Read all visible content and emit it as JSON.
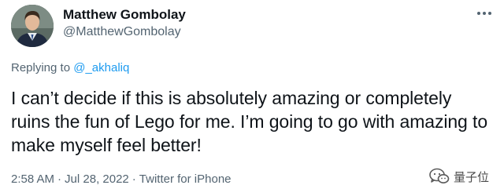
{
  "author": {
    "name": "Matthew Gombolay",
    "handle": "@MatthewGombolay"
  },
  "reply": {
    "prefix": "Replying to ",
    "mention": "@_akhaliq"
  },
  "tweet": {
    "text": "I can’t decide if this is absolutely amazing or completely ruins the fun of Lego for me. I’m going to go with amazing to make myself feel better!"
  },
  "meta": {
    "time": "2:58 AM",
    "date": "Jul 28, 2022",
    "source": "Twitter for iPhone",
    "separator": "·"
  },
  "watermark": {
    "label": "量子位",
    "icon": "wechat-icon"
  },
  "colors": {
    "link": "#1d9bf0",
    "secondary_text": "#536471",
    "primary_text": "#0f1419"
  }
}
